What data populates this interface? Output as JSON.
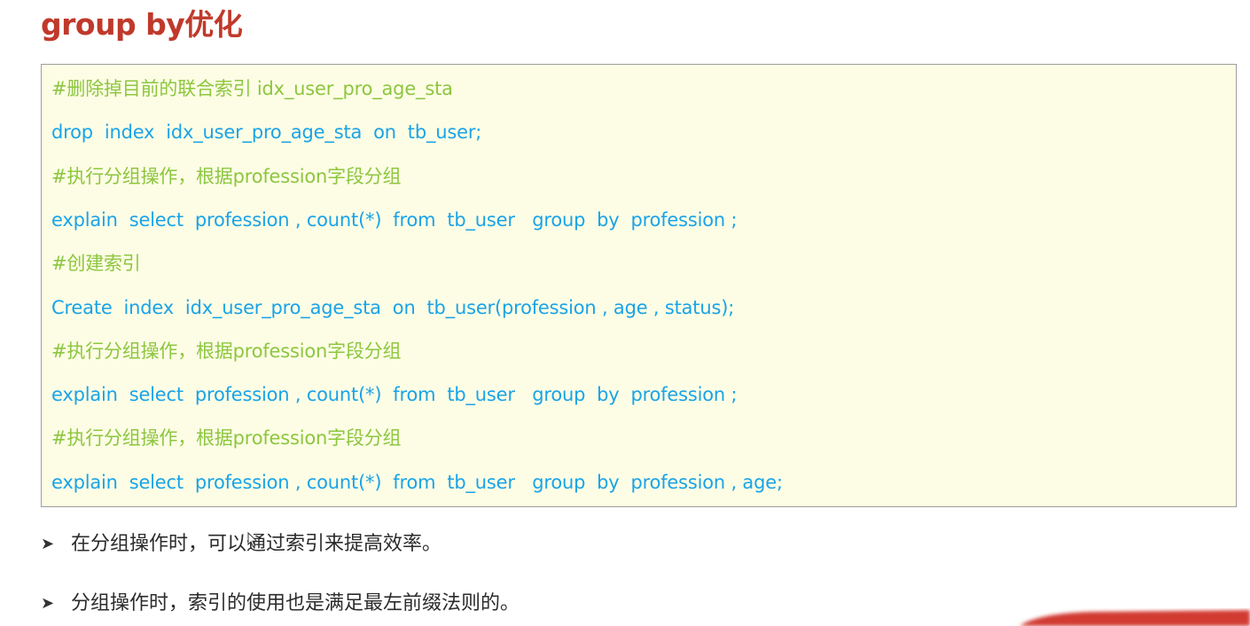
{
  "title": "group by优化",
  "colors": {
    "title": "#c0392b",
    "comment": "#8dc63f",
    "code": "#1aa3e8",
    "code_background": "#fdfde5",
    "bullet_text": "#2b2b2b"
  },
  "code_lines": [
    {
      "type": "comment",
      "text": "#删除掉目前的联合索引 idx_user_pro_age_sta"
    },
    {
      "type": "code",
      "text": "drop  index  idx_user_pro_age_sta  on  tb_user;"
    },
    {
      "type": "comment",
      "text": "#执行分组操作，根据profession字段分组"
    },
    {
      "type": "code",
      "text": "explain  select  profession , count(*)  from  tb_user   group  by  profession ;"
    },
    {
      "type": "comment",
      "text": "#创建索引"
    },
    {
      "type": "code",
      "text": "Create  index  idx_user_pro_age_sta  on  tb_user(profession , age , status);"
    },
    {
      "type": "comment",
      "text": "#执行分组操作，根据profession字段分组"
    },
    {
      "type": "code",
      "text": "explain  select  profession , count(*)  from  tb_user   group  by  profession ;"
    },
    {
      "type": "comment",
      "text": "#执行分组操作，根据profession字段分组"
    },
    {
      "type": "code",
      "text": "explain  select  profession , count(*)  from  tb_user   group  by  profession , age;"
    }
  ],
  "bullets": [
    {
      "icon": "arrow-bullet-icon",
      "text": "在分组操作时，可以通过索引来提高效率。"
    },
    {
      "icon": "arrow-bullet-icon",
      "text": "分组操作时，索引的使用也是满足最左前缀法则的。"
    }
  ]
}
